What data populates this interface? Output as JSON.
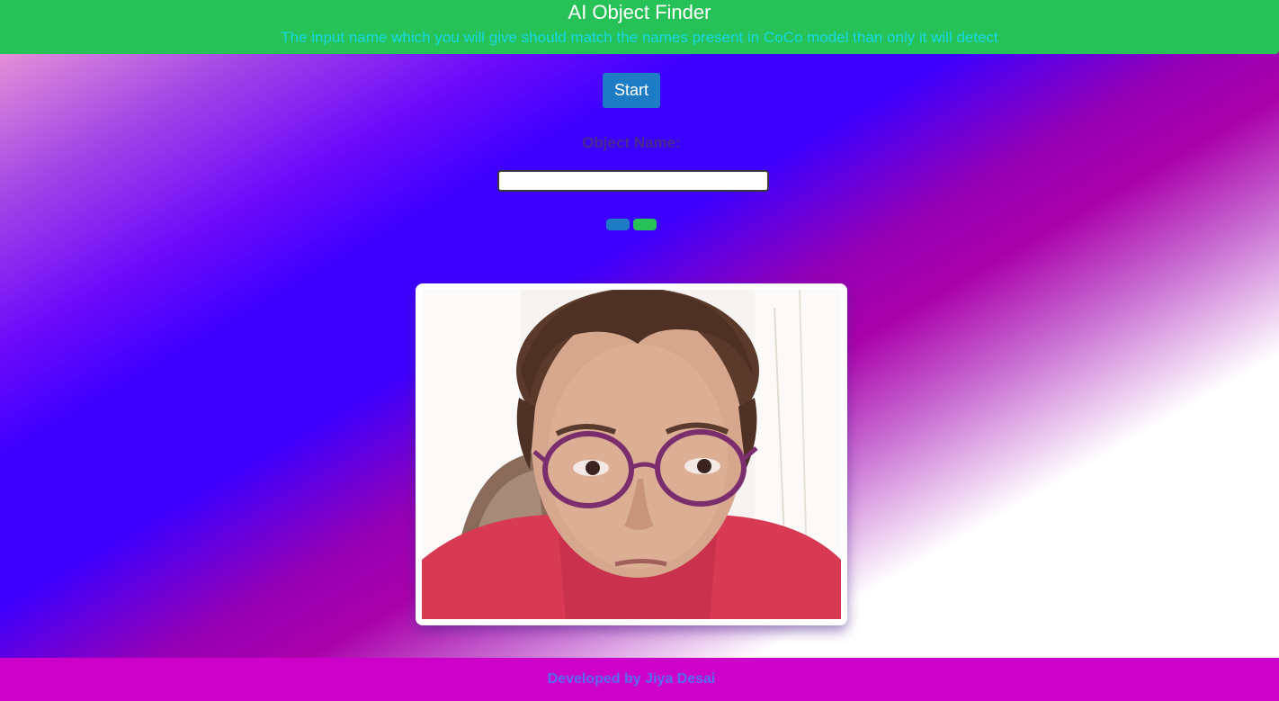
{
  "header": {
    "title": "AI Object Finder",
    "subtitle": "The input name which you will give should match the names present in CoCo model than only it will detect"
  },
  "controls": {
    "start_label": "Start",
    "object_name_label": "Object Name:",
    "object_name_value": "",
    "mini_buttons": [
      {
        "color": "#1d7cc4"
      },
      {
        "color": "#27c257"
      }
    ]
  },
  "video": {
    "content": "webcam feed"
  },
  "footer": {
    "credit": "Developed by Jiya Desai"
  },
  "colors": {
    "header_bg": "#27c257",
    "subtitle": "#19d6e4",
    "start_button": "#1d7cc4",
    "footer_bg": "#cc00c8",
    "footer_text": "#5a6cf0"
  }
}
